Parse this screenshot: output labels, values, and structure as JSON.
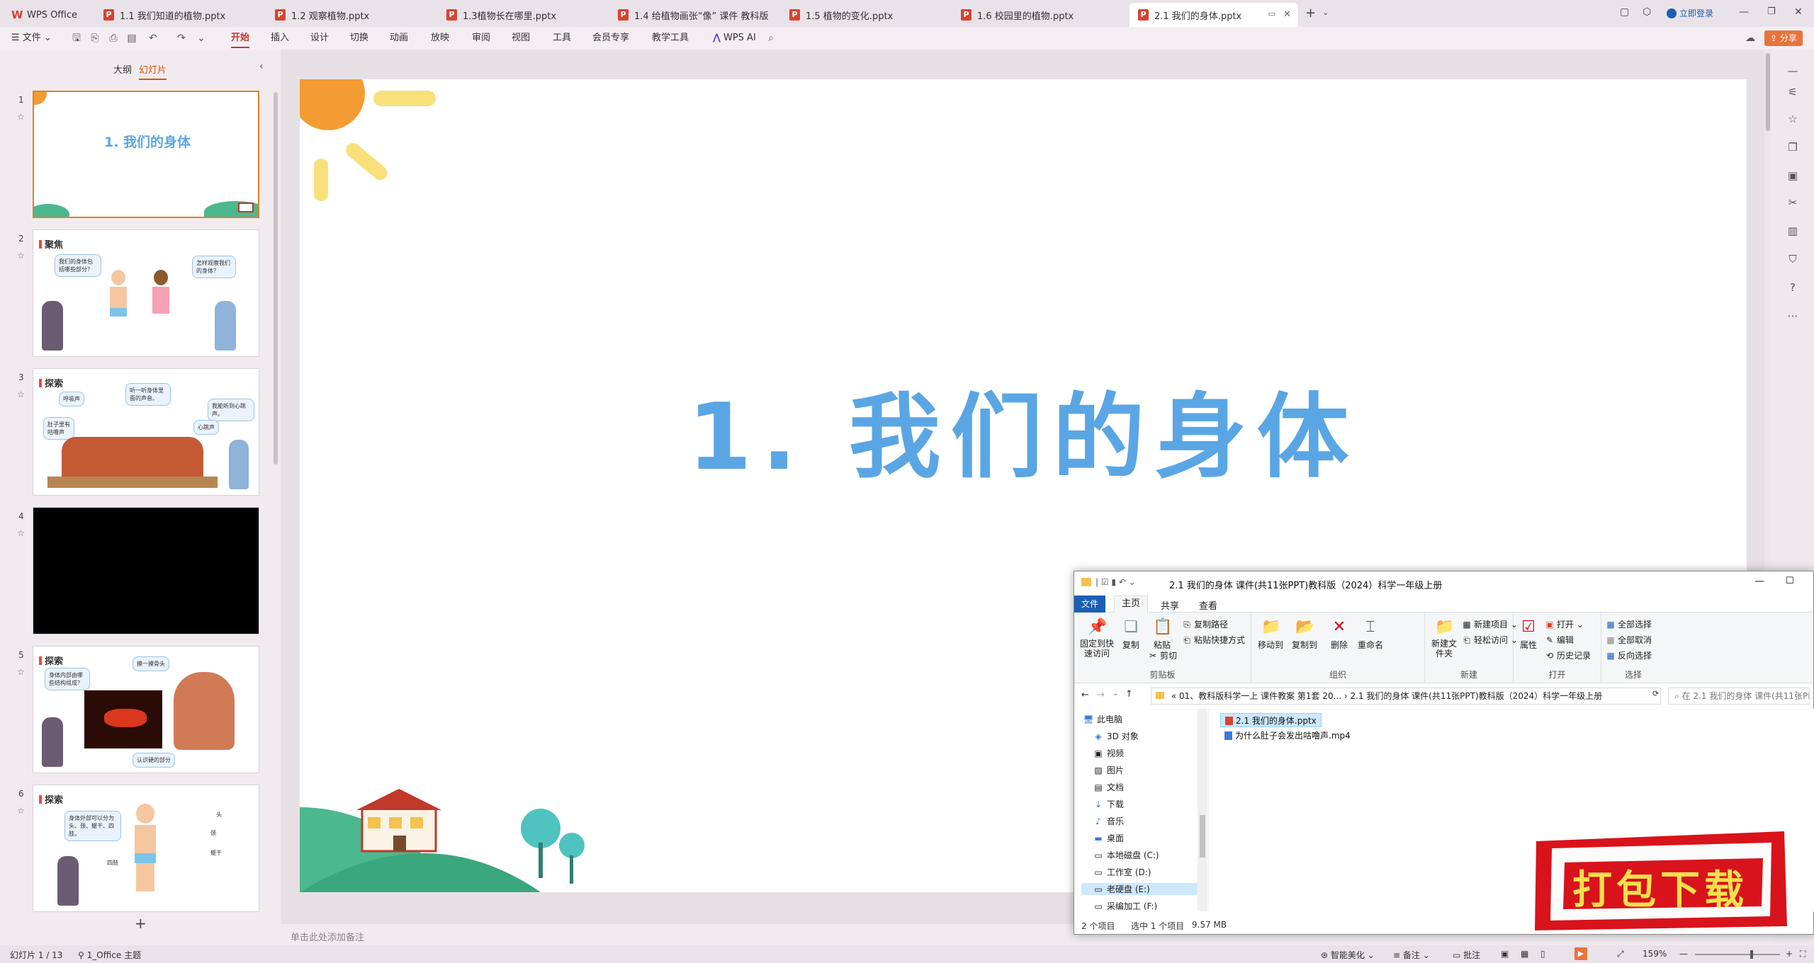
{
  "tabs": [
    {
      "label": "WPS Office",
      "icon": "wps-logo-icon"
    },
    {
      "label": "1.1 我们知道的植物.pptx"
    },
    {
      "label": "1.2 观察植物.pptx"
    },
    {
      "label": "1.3植物长在哪里.pptx"
    },
    {
      "label": "1.4 给植物画张“像” 课件 教科版"
    },
    {
      "label": "1.5 植物的变化.pptx"
    },
    {
      "label": "1.6 校园里的植物.pptx"
    },
    {
      "label": "2.1 我们的身体.pptx"
    }
  ],
  "topright": {
    "login": "立即登录"
  },
  "ribbon": {
    "file": "文件",
    "menus": [
      "开始",
      "插入",
      "设计",
      "切换",
      "动画",
      "放映",
      "审阅",
      "视图",
      "工具",
      "会员专享",
      "教学工具"
    ],
    "active_menu": "开始",
    "wps_ai": "WPS AI",
    "share": "分享"
  },
  "left_panel": {
    "tab_outline": "大纲",
    "tab_slides": "幻灯片",
    "slides": [
      {
        "num": "1",
        "title": "1. 我们的身体"
      },
      {
        "num": "2",
        "heading": "聚焦",
        "bubble_left": "我们的身体包括哪些部分？",
        "bubble_right": "怎样观察我们的身体？"
      },
      {
        "num": "3",
        "heading": "探索",
        "bubbles": [
          "呼吸声",
          "听一听身体里面的声音。",
          "肚子里有咕噜声",
          "我能听到心跳声。",
          "心跳声"
        ]
      },
      {
        "num": "4"
      },
      {
        "num": "5",
        "heading": "探索",
        "bubbles": [
          "身体内部由哪些结构组成？",
          "摸一摸骨头",
          "认识硬的部分"
        ]
      },
      {
        "num": "6",
        "heading": "探索",
        "bubbles": [
          "身体外部可以分为头、颈、躯干、四肢。"
        ],
        "labels": [
          "头",
          "颈",
          "躯干",
          "四肢"
        ]
      }
    ],
    "add_icon": "plus-icon"
  },
  "slide": {
    "title": "1. 我们的身体"
  },
  "notes_placeholder": "单击此处添加备注",
  "status": {
    "slide_info": "幻灯片 1 / 13",
    "theme": "1_Office 主题",
    "beautify": "智能美化",
    "notes": "备注",
    "comments": "批注",
    "zoom": "159%"
  },
  "explorer": {
    "title": "2.1 我们的身体 课件(共11张PPT)教科版（2024）科学一年级上册",
    "tabs": [
      "文件",
      "主页",
      "共享",
      "查看"
    ],
    "active_tab": "主页",
    "groups": {
      "clipboard": {
        "label": "剪贴板",
        "pin": "固定到快速访问",
        "copy": "复制",
        "paste": "粘贴",
        "copy_path": "复制路径",
        "paste_shortcut": "粘贴快捷方式",
        "cut": "剪切"
      },
      "organize": {
        "label": "组织",
        "move_to": "移动到",
        "copy_to": "复制到",
        "delete": "删除",
        "rename": "重命名"
      },
      "new": {
        "label": "新建",
        "new_folder": "新建文件夹",
        "new_item": "新建项目",
        "easy_access": "轻松访问"
      },
      "open": {
        "label": "打开",
        "properties": "属性",
        "open": "打开",
        "edit": "编辑",
        "history": "历史记录"
      },
      "select": {
        "label": "选择",
        "select_all": "全部选择",
        "select_none": "全部取消",
        "invert": "反向选择"
      }
    },
    "address": "« 01、教科版科学一上 课件教案 第1套 20...  ›  2.1 我们的身体 课件(共11张PPT)教科版（2024）科学一年级上册",
    "search_placeholder": "在 2.1 我们的身体 课件(共11张PPT...",
    "nav": [
      {
        "label": "此电脑",
        "icon": "computer-icon"
      },
      {
        "label": "3D 对象",
        "icon": "cube-icon"
      },
      {
        "label": "视频",
        "icon": "video-icon"
      },
      {
        "label": "图片",
        "icon": "picture-icon"
      },
      {
        "label": "文档",
        "icon": "document-icon"
      },
      {
        "label": "下载",
        "icon": "download-icon"
      },
      {
        "label": "音乐",
        "icon": "music-icon"
      },
      {
        "label": "桌面",
        "icon": "desktop-icon"
      },
      {
        "label": "本地磁盘 (C:)",
        "icon": "drive-icon"
      },
      {
        "label": "工作室 (D:)",
        "icon": "drive-icon"
      },
      {
        "label": "老硬盘 (E:)",
        "icon": "drive-icon"
      },
      {
        "label": "采编加工 (F:)",
        "icon": "drive-icon"
      }
    ],
    "files": [
      {
        "name": "2.1 我们的身体.pptx",
        "icon": "pptx-file-icon"
      },
      {
        "name": "为什么肚子会发出咕噜声.mp4",
        "icon": "video-file-icon"
      }
    ],
    "status": {
      "count": "2 个项目",
      "selected": "选中 1 个项目",
      "size": "9.57 MB"
    }
  },
  "download_badge": {
    "text": "打包下载"
  }
}
